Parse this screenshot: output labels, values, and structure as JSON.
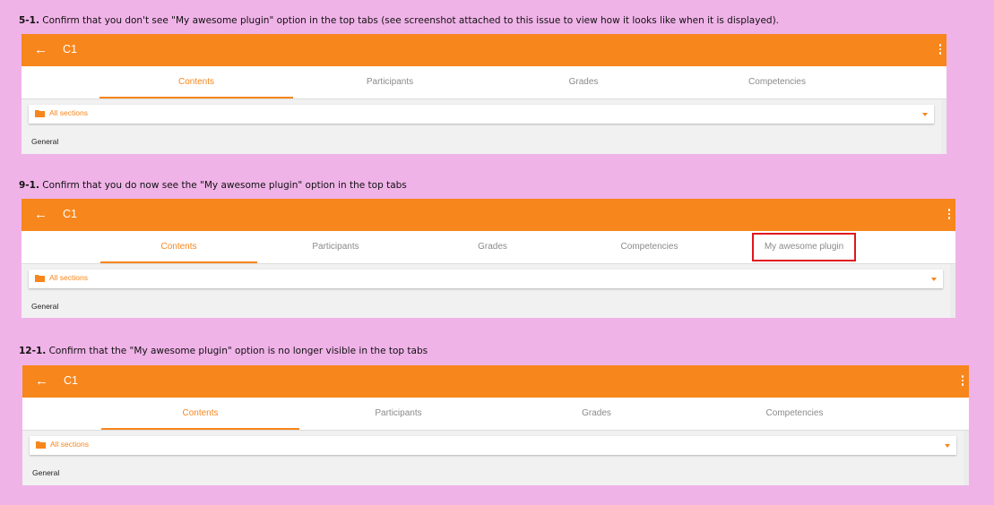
{
  "steps": [
    {
      "label": "5-1.",
      "text": " Confirm that you don't see \"My awesome plugin\" option in the top tabs (see screenshot attached to this issue to view how it looks like when it is displayed).",
      "course_title": "C1",
      "back_icon": "←",
      "tabs": [
        "Contents",
        "Participants",
        "Grades",
        "Competencies"
      ],
      "section_selector": "All sections",
      "section_name": "General"
    },
    {
      "label": "9-1.",
      "text": " Confirm that you do now see the \"My awesome plugin\" option in the top tabs",
      "course_title": "C1",
      "back_icon": "←",
      "tabs": [
        "Contents",
        "Participants",
        "Grades",
        "Competencies",
        "My awesome plugin"
      ],
      "section_selector": "All sections",
      "section_name": "General"
    },
    {
      "label": "12-1.",
      "text": " Confirm that the \"My awesome plugin\" option is no longer visible in the top tabs",
      "course_title": "C1",
      "back_icon": "←",
      "tabs": [
        "Contents",
        "Participants",
        "Grades",
        "Competencies"
      ],
      "section_selector": "All sections",
      "section_name": "General"
    }
  ],
  "colors": {
    "background": "#f0b3e8",
    "accent": "#f7861c",
    "highlight_box": "#e0161c"
  },
  "icons": [
    "back-arrow-icon",
    "more-vert-icon",
    "folder-icon",
    "caret-down-icon"
  ]
}
